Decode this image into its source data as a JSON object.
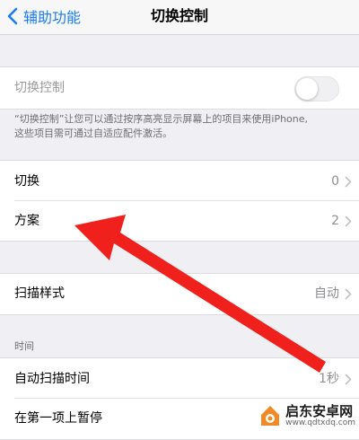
{
  "navbar": {
    "back_label": "辅助功能",
    "title": "切换控制"
  },
  "switch_control": {
    "label": "切换控制",
    "enabled": false
  },
  "footnote": {
    "line1": "“切换控制”让您可以通过按序高亮显示屏幕上的项目来使用iPhone,",
    "line2": "这些项目需可通过自适应配件激活。"
  },
  "group1": {
    "items": [
      {
        "label": "切换",
        "value": "0"
      },
      {
        "label": "方案",
        "value": "2"
      }
    ]
  },
  "group2": {
    "items": [
      {
        "label": "扫描样式",
        "value": "自动"
      }
    ]
  },
  "time_section": {
    "header": "时间",
    "items": [
      {
        "label": "自动扫描时间",
        "value": "1秒"
      },
      {
        "label": "在第一项上暂停",
        "value": ""
      }
    ]
  },
  "watermark": {
    "name": "启东安卓网",
    "url": "www.qdtxdq.com"
  },
  "colors": {
    "accent": "#1a7cf5",
    "annotation_arrow": "#f0201c",
    "background": "#efeff4"
  }
}
